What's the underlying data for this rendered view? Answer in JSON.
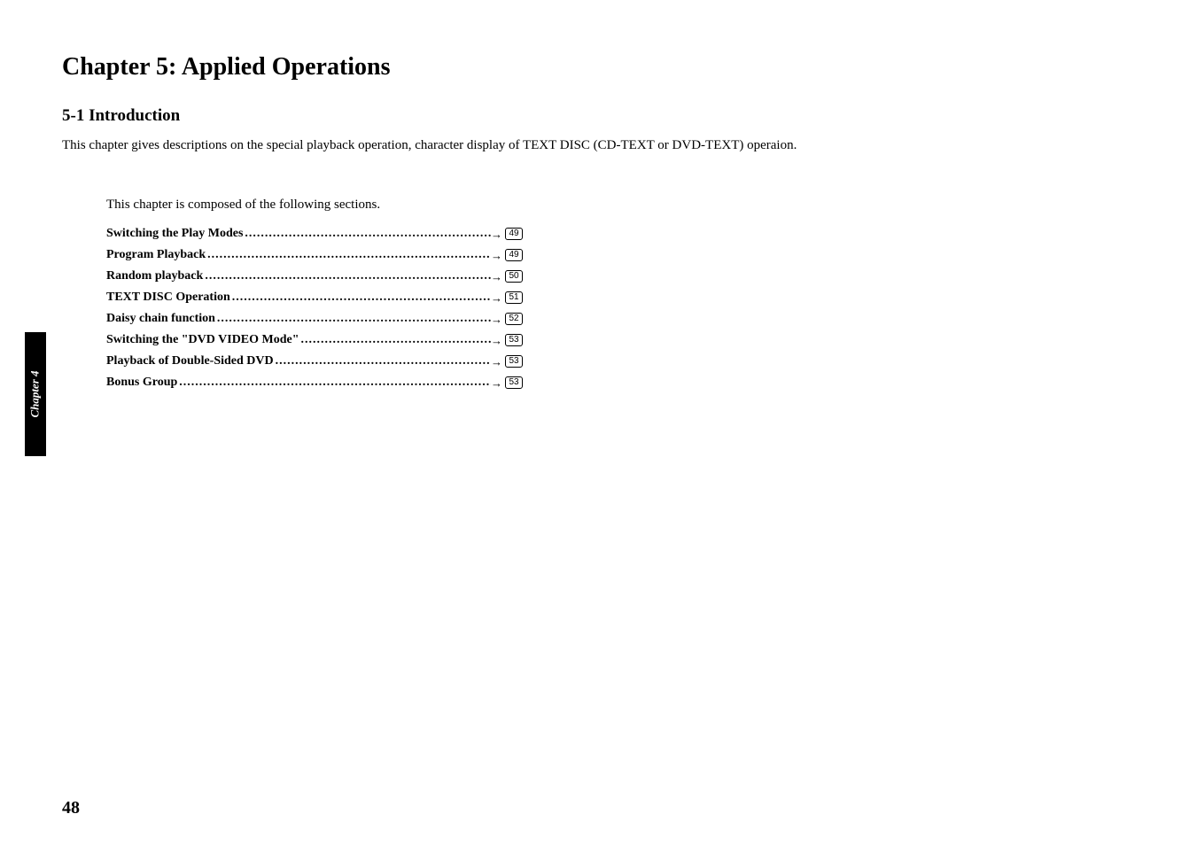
{
  "sidebar": {
    "tab_label": "Chapter 4"
  },
  "header": {
    "chapter_title": "Chapter 5: Applied Operations",
    "section_title": "5-1  Introduction",
    "intro_text": "This chapter gives descriptions on the special playback operation, character display of TEXT DISC (CD-TEXT or DVD-TEXT) operaion."
  },
  "toc": {
    "intro": "This chapter is composed of the following sections.",
    "items": [
      {
        "label": "Switching the Play Modes",
        "page": "49"
      },
      {
        "label": "Program Playback ",
        "page": "49"
      },
      {
        "label": "Random playback ",
        "page": "50"
      },
      {
        "label": "TEXT DISC Operation",
        "page": "51"
      },
      {
        "label": "Daisy chain function ",
        "page": "52"
      },
      {
        "label": "Switching the \"DVD VIDEO Mode\" ",
        "page": "53"
      },
      {
        "label": "Playback of Double-Sided DVD",
        "page": "53"
      },
      {
        "label": "Bonus Group ",
        "page": "53"
      }
    ]
  },
  "footer": {
    "page_number": "48"
  }
}
